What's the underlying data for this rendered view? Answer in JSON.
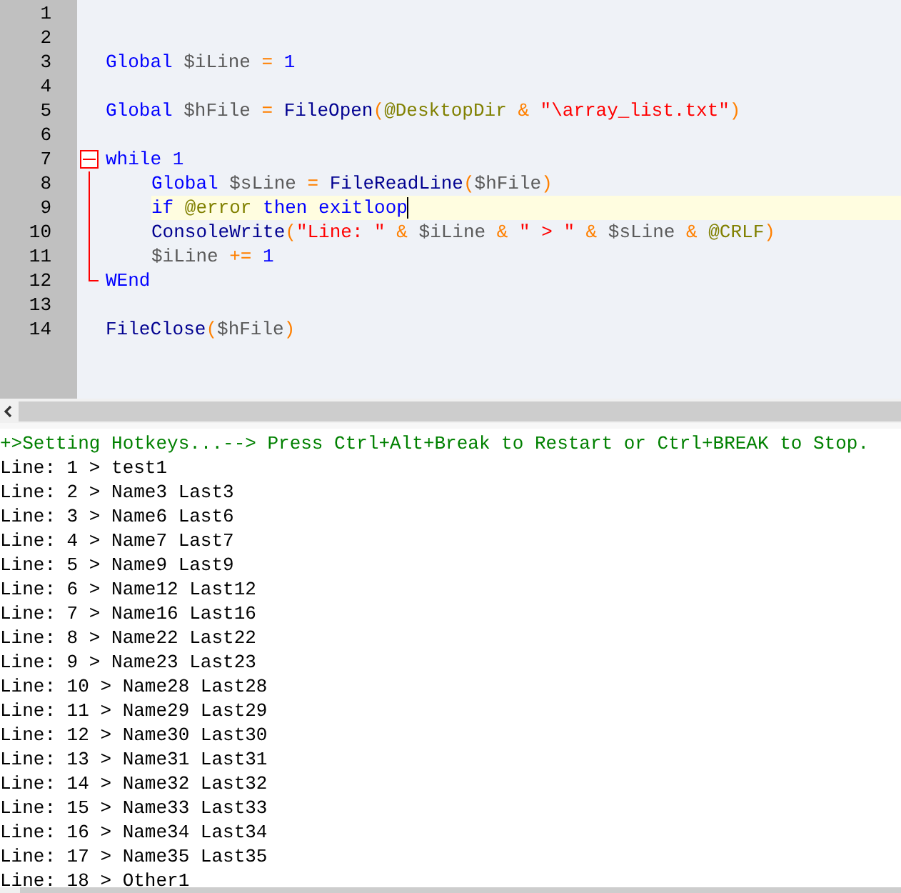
{
  "editor": {
    "lines": [
      {
        "number": "1",
        "current": false
      },
      {
        "number": "2",
        "current": false
      },
      {
        "number": "3",
        "current": false,
        "tokens": [
          {
            "kind": "keyword",
            "text": "Global "
          },
          {
            "kind": "variable",
            "text": "$iLine"
          },
          {
            "kind": "operator",
            "text": " = "
          },
          {
            "kind": "number",
            "text": "1"
          }
        ]
      },
      {
        "number": "4",
        "current": false
      },
      {
        "number": "5",
        "current": false,
        "tokens": [
          {
            "kind": "keyword",
            "text": "Global "
          },
          {
            "kind": "variable",
            "text": "$hFile"
          },
          {
            "kind": "operator",
            "text": " = "
          },
          {
            "kind": "function",
            "text": "FileOpen"
          },
          {
            "kind": "operator",
            "text": "("
          },
          {
            "kind": "macro",
            "text": "@DesktopDir"
          },
          {
            "kind": "operator",
            "text": " & "
          },
          {
            "kind": "string",
            "text": "\"\\array_list.txt\""
          },
          {
            "kind": "operator",
            "text": ")"
          }
        ]
      },
      {
        "number": "6",
        "current": false
      },
      {
        "number": "7",
        "current": false,
        "expanded": true,
        "tokens": [
          {
            "kind": "keyword",
            "text": "while "
          },
          {
            "kind": "number",
            "text": "1"
          }
        ],
        "children": [
          {
            "number": "8",
            "current": false,
            "tokens": [
              {
                "kind": "keyword",
                "text": "Global "
              },
              {
                "kind": "variable",
                "text": "$sLine"
              },
              {
                "kind": "operator",
                "text": " = "
              },
              {
                "kind": "function",
                "text": "FileReadLine"
              },
              {
                "kind": "operator",
                "text": "("
              },
              {
                "kind": "variable",
                "text": "$hFile"
              },
              {
                "kind": "operator",
                "text": ")"
              }
            ]
          },
          {
            "number": "9",
            "current": true,
            "tokens": [
              {
                "kind": "keyword",
                "text": "if "
              },
              {
                "kind": "macro",
                "text": "@error"
              },
              {
                "kind": "keyword",
                "text": " then exitloop"
              }
            ]
          },
          {
            "number": "10",
            "current": false,
            "tokens": [
              {
                "kind": "function",
                "text": "ConsoleWrite"
              },
              {
                "kind": "operator",
                "text": "("
              },
              {
                "kind": "string",
                "text": "\"Line: \""
              },
              {
                "kind": "operator",
                "text": " & "
              },
              {
                "kind": "variable",
                "text": "$iLine"
              },
              {
                "kind": "operator",
                "text": " & "
              },
              {
                "kind": "string",
                "text": "\" > \""
              },
              {
                "kind": "operator",
                "text": " & "
              },
              {
                "kind": "variable",
                "text": "$sLine"
              },
              {
                "kind": "operator",
                "text": " & "
              },
              {
                "kind": "macro",
                "text": "@CRLF"
              },
              {
                "kind": "operator",
                "text": ")"
              }
            ]
          },
          {
            "number": "11",
            "current": false,
            "tokens": [
              {
                "kind": "variable",
                "text": "$iLine"
              },
              {
                "kind": "operator",
                "text": " += "
              },
              {
                "kind": "number",
                "text": "1"
              }
            ]
          }
        ]
      },
      {
        "number": "12",
        "current": false,
        "fold_end": true,
        "tokens": [
          {
            "kind": "keyword",
            "text": "WEnd"
          }
        ]
      },
      {
        "number": "13",
        "current": false
      },
      {
        "number": "14",
        "current": false,
        "tokens": [
          {
            "kind": "function",
            "text": "FileClose"
          },
          {
            "kind": "operator",
            "text": "("
          },
          {
            "kind": "variable",
            "text": "$hFile"
          },
          {
            "kind": "operator",
            "text": ")"
          }
        ]
      }
    ]
  },
  "output": {
    "lines": [
      {
        "kind": "info",
        "text": "+>Setting Hotkeys...--> Press Ctrl+Alt+Break to Restart or Ctrl+BREAK to Stop."
      },
      {
        "kind": "plain",
        "text": "Line: 1 > test1"
      },
      {
        "kind": "plain",
        "text": "Line: 2 > Name3 Last3"
      },
      {
        "kind": "plain",
        "text": "Line: 3 > Name6 Last6"
      },
      {
        "kind": "plain",
        "text": "Line: 4 > Name7 Last7"
      },
      {
        "kind": "plain",
        "text": "Line: 5 > Name9 Last9"
      },
      {
        "kind": "plain",
        "text": "Line: 6 > Name12 Last12"
      },
      {
        "kind": "plain",
        "text": "Line: 7 > Name16 Last16"
      },
      {
        "kind": "plain",
        "text": "Line: 8 > Name22 Last22"
      },
      {
        "kind": "plain",
        "text": "Line: 9 > Name23 Last23"
      },
      {
        "kind": "plain",
        "text": "Line: 10 > Name28 Last28"
      },
      {
        "kind": "plain",
        "text": "Line: 11 > Name29 Last29"
      },
      {
        "kind": "plain",
        "text": "Line: 12 > Name30 Last30"
      },
      {
        "kind": "plain",
        "text": "Line: 13 > Name31 Last31"
      },
      {
        "kind": "plain",
        "text": "Line: 14 > Name32 Last32"
      },
      {
        "kind": "plain",
        "text": "Line: 15 > Name33 Last33"
      },
      {
        "kind": "plain",
        "text": "Line: 16 > Name34 Last34"
      },
      {
        "kind": "plain",
        "text": "Line: 17 > Name35 Last35"
      },
      {
        "kind": "plain",
        "text": "Line: 18 > Other1"
      }
    ]
  }
}
